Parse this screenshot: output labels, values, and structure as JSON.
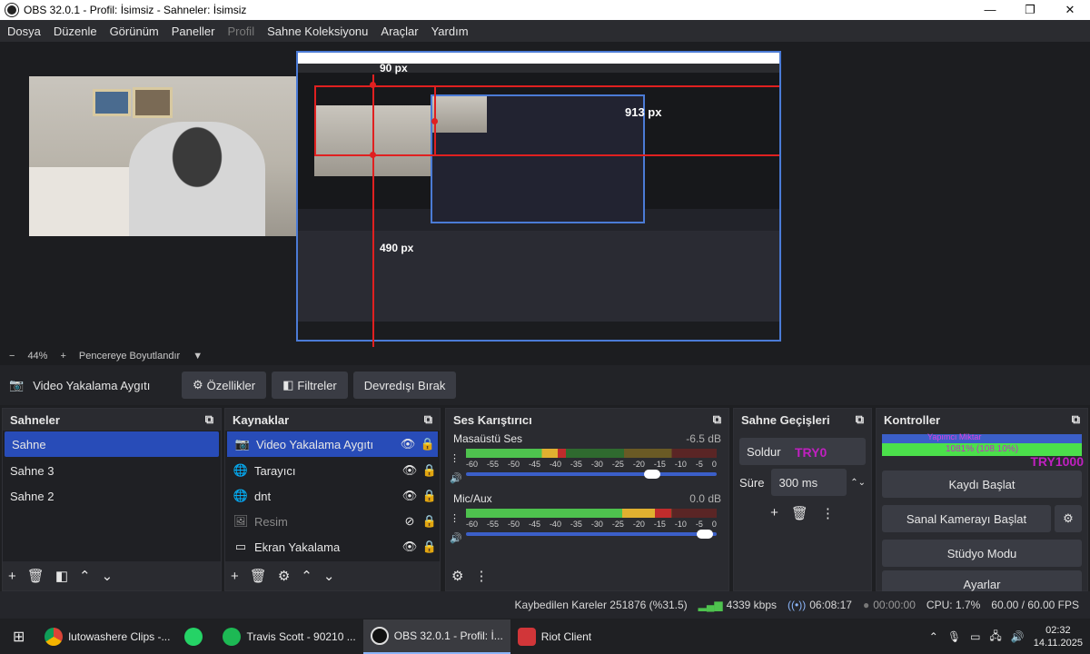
{
  "window": {
    "title": "OBS 32.0.1 - Profil: İsimsiz - Sahneler: İsimsiz",
    "controls": [
      "—",
      "❐",
      "✕"
    ]
  },
  "menu": [
    "Dosya",
    "Düzenle",
    "Görünüm",
    "Paneller",
    "Profil",
    "Sahne Koleksiyonu",
    "Araçlar",
    "Yardım"
  ],
  "preview": {
    "labels": {
      "top": "90 px",
      "right": "913 px",
      "bottom": "490 px"
    }
  },
  "zoom": {
    "minus": "−",
    "value": "44%",
    "plus": "+",
    "mode": "Pencereye Boyutlandır"
  },
  "source_bar": {
    "name": "Video Yakalama Aygıtı",
    "props": "Özellikler",
    "filters": "Filtreler",
    "disable": "Devredışı Bırak"
  },
  "scenes": {
    "title": "Sahneler",
    "items": [
      "Sahne",
      "Sahne 3",
      "Sahne 2"
    ]
  },
  "sources": {
    "title": "Kaynaklar",
    "items": [
      {
        "label": "Video Yakalama Aygıtı",
        "icon": "camera-icon"
      },
      {
        "label": "Tarayıcı",
        "icon": "globe-icon"
      },
      {
        "label": "dnt",
        "icon": "globe-icon"
      },
      {
        "label": "Resim",
        "icon": "image-icon"
      },
      {
        "label": "Ekran Yakalama",
        "icon": "monitor-icon"
      }
    ]
  },
  "mixer": {
    "title": "Ses Karıştırıcı",
    "ticks": [
      "-60",
      "-55",
      "-50",
      "-45",
      "-40",
      "-35",
      "-30",
      "-25",
      "-20",
      "-15",
      "-10",
      "-5",
      "0"
    ],
    "channels": [
      {
        "name": "Masaüstü Ses",
        "db": "-6.5 dB",
        "level": 0.4,
        "volume": 0.75
      },
      {
        "name": "Mic/Aux",
        "db": "0.0 dB",
        "level": 0.82,
        "volume": 0.97
      }
    ]
  },
  "transitions": {
    "title": "Sahne Geçişleri",
    "type": "Soldur",
    "duration_label": "Süre",
    "duration": "300 ms"
  },
  "controls": {
    "title": "Kontroller",
    "overlay": "1081% (108.10%)",
    "overlay_try_left": "TRY0",
    "overlay_try_right": "TRY1000",
    "overlay_top": "Yapımcı Miktar",
    "buttons": [
      "Kaydı Başlat",
      "Sanal Kamerayı Başlat",
      "Stüdyo Modu",
      "Ayarlar"
    ]
  },
  "status": {
    "dropped": "Kaybedilen Kareler 251876 (%31.5)",
    "kbps": "4339 kbps",
    "stream_time": "06:08:17",
    "rec_time": "00:00:00",
    "cpu": "CPU: 1.7%",
    "fps": "60.00 / 60.00 FPS"
  },
  "taskbar": {
    "items": [
      "lutowashere Clips -...",
      "",
      "Travis Scott - 90210 ...",
      "OBS 32.0.1 - Profil: İ...",
      "Riot Client"
    ],
    "time": "02:32",
    "date": "14.11.2025"
  }
}
